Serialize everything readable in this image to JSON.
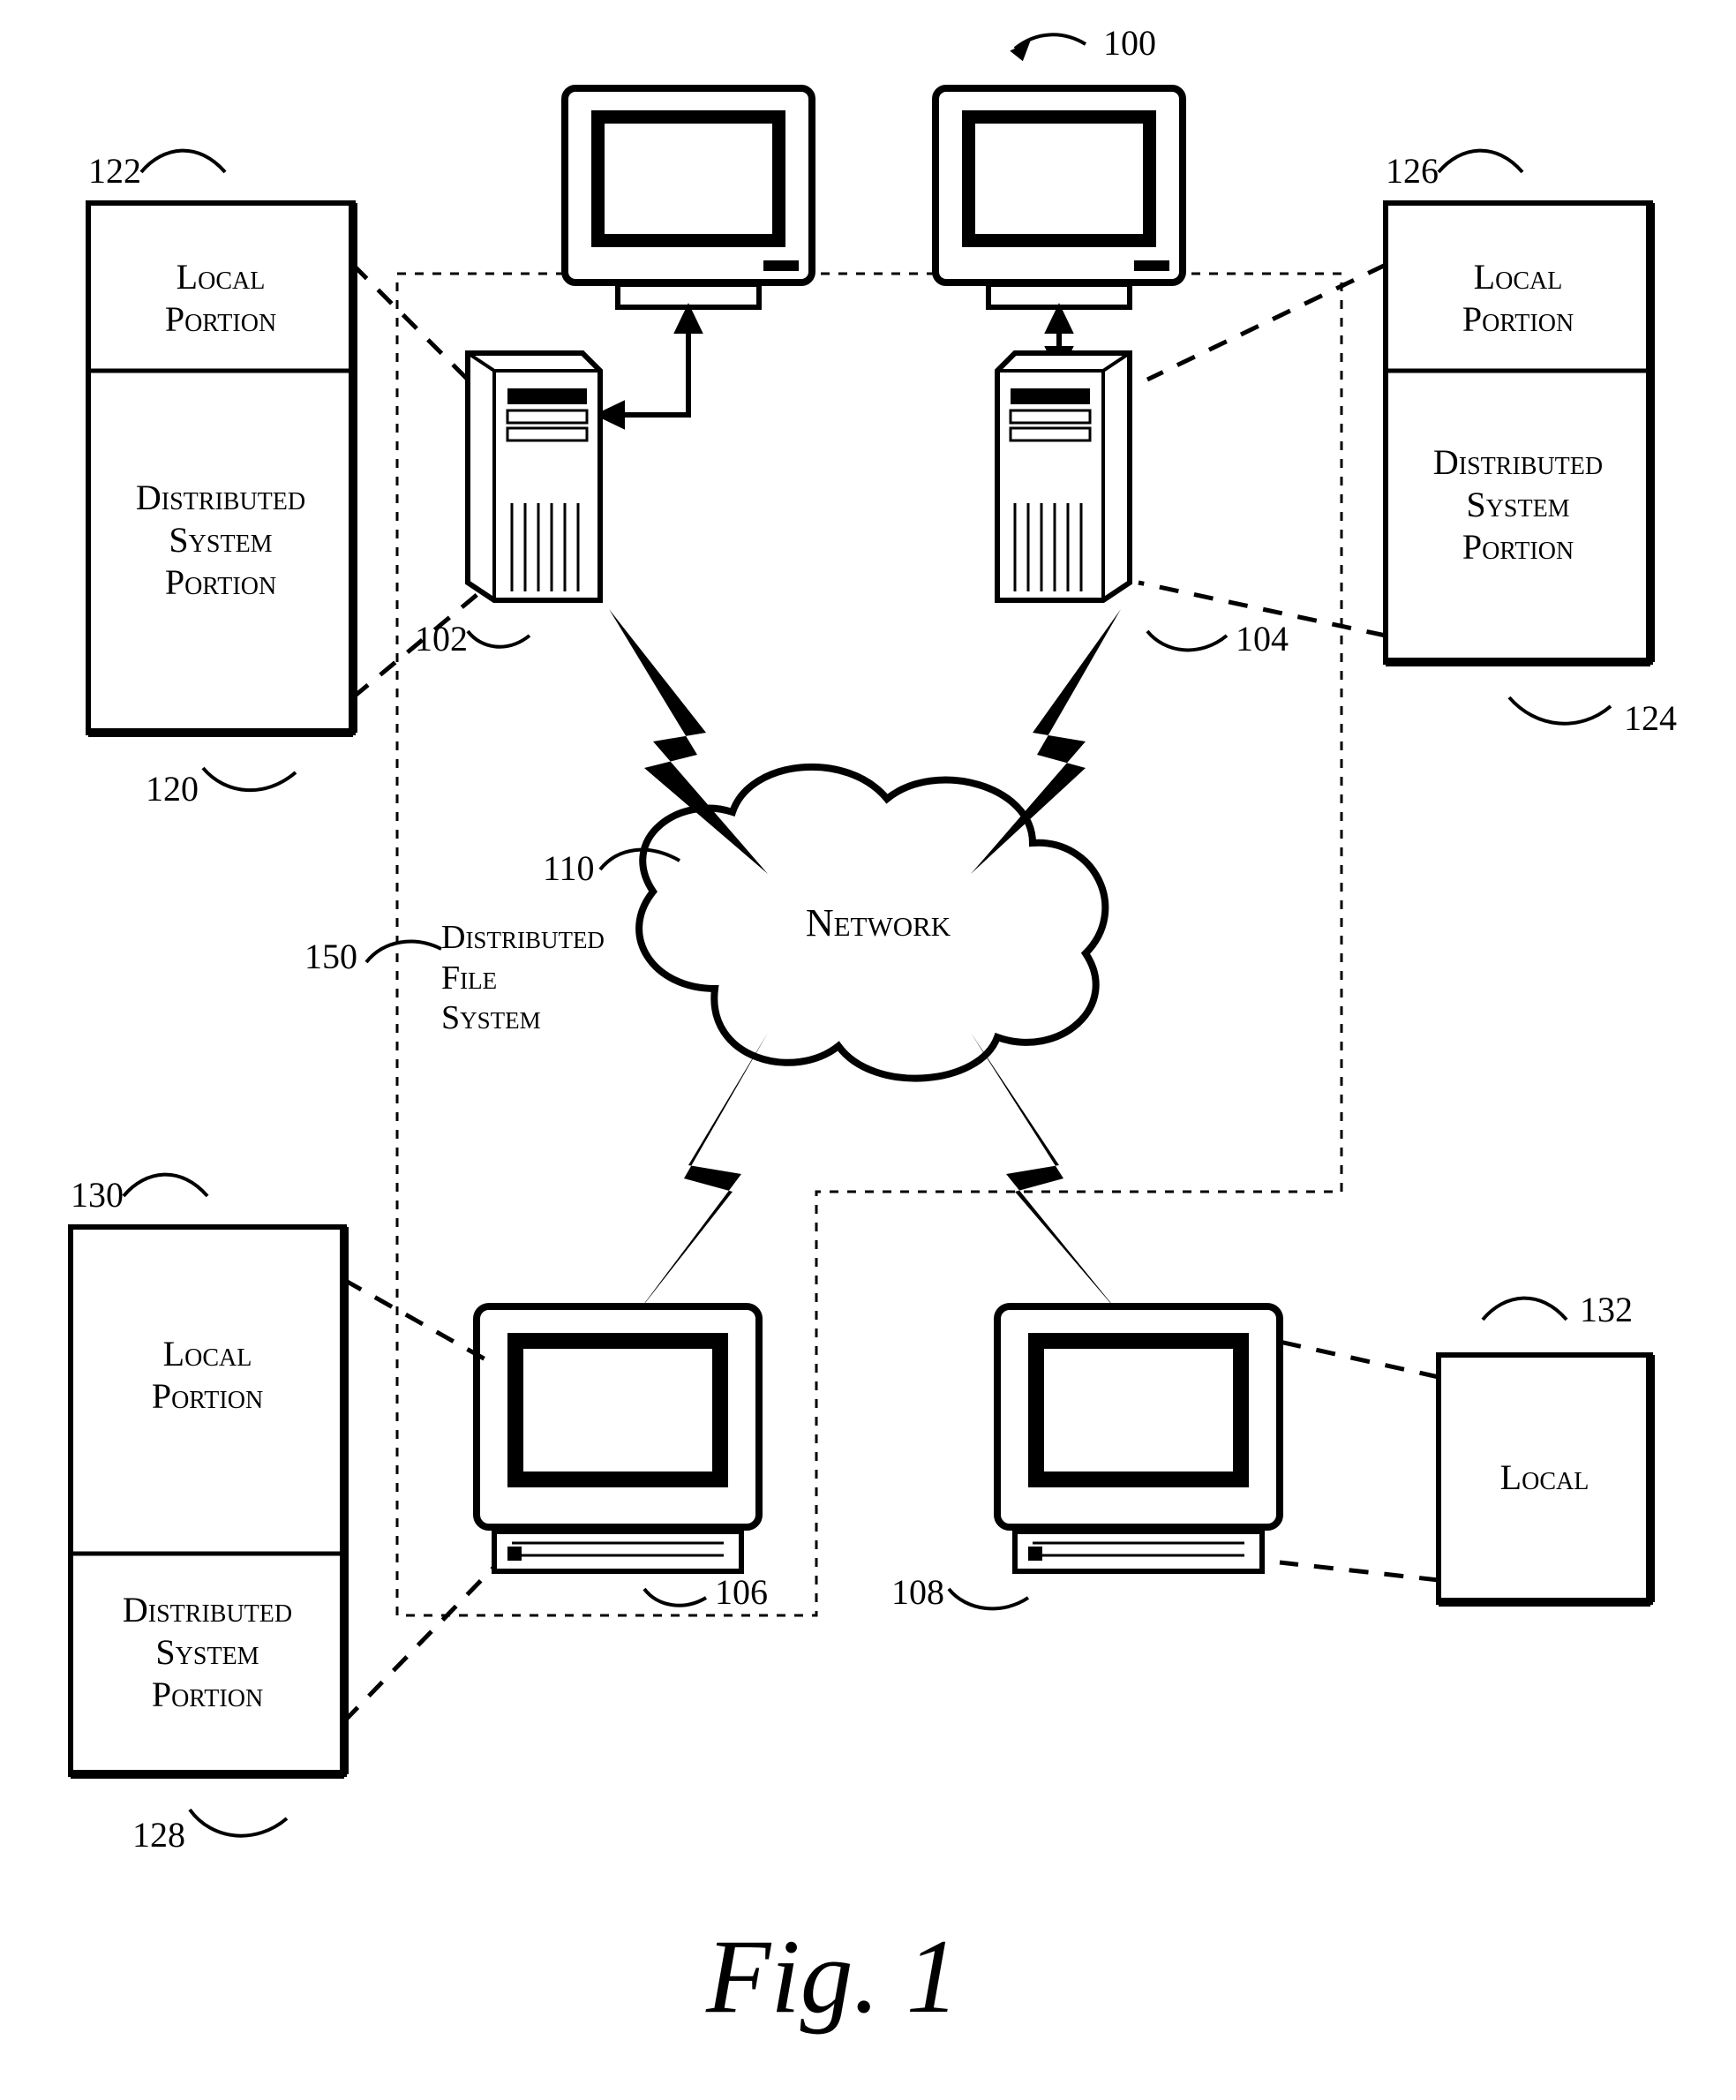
{
  "figure_ref": "100",
  "figure_caption": "Fig. 1",
  "network_label": "Network",
  "network_ref": "110",
  "dfs_ref": "150",
  "dfs_label": "Distributed\nFile\nSystem",
  "nodes": {
    "n102": {
      "ref": "102"
    },
    "n104": {
      "ref": "104"
    },
    "n106": {
      "ref": "106"
    },
    "n108": {
      "ref": "108"
    }
  },
  "boxes": {
    "b120": {
      "ref": "120",
      "local_ref": "122",
      "local_label": "Local\nPortion",
      "dist_label": "Distributed\nSystem\nPortion"
    },
    "b124": {
      "ref": "124",
      "local_ref": "126",
      "local_label": "Local\nPortion",
      "dist_label": "Distributed\nSystem\nPortion"
    },
    "b128": {
      "ref": "128",
      "local_ref": "130",
      "local_label": "Local\nPortion",
      "dist_label": "Distributed\nSystem\nPortion"
    },
    "b132": {
      "ref": "132",
      "label": "Local"
    }
  }
}
